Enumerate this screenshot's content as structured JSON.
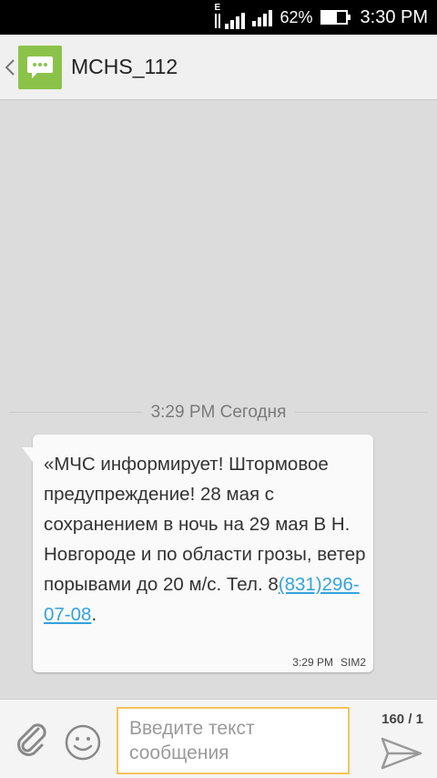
{
  "status_bar": {
    "network_type": "E",
    "battery_percent": "62%",
    "battery_level": 0.62,
    "time": "3:30 PM"
  },
  "header": {
    "back_icon": "chevron-left-icon",
    "app_icon": "message-bubble-icon",
    "app_icon_color": "#8bc34a",
    "title": "MCHS_112"
  },
  "conversation": {
    "date_divider": "3:29 PM Сегодня",
    "messages": [
      {
        "text_before_link": "«МЧС информирует! Штормовое предупреждение! 28 мая с сохранением в ночь на 29 мая В Н. Новгороде и по области грозы, ветер порывами до 20 м/с. Тел. 8",
        "link": "(831)296-07-08",
        "text_after_link": ".",
        "time": "3:29 PM",
        "sim": "SIM2"
      }
    ]
  },
  "compose": {
    "attach_icon": "paperclip-icon",
    "emoji_icon": "smiley-icon",
    "placeholder": "Введите текст сообщения",
    "counter": "160 / 1",
    "send_icon": "send-icon"
  },
  "colors": {
    "background": "#dcdcdc",
    "link": "#33a3dc",
    "input_border": "#f7c35a"
  }
}
